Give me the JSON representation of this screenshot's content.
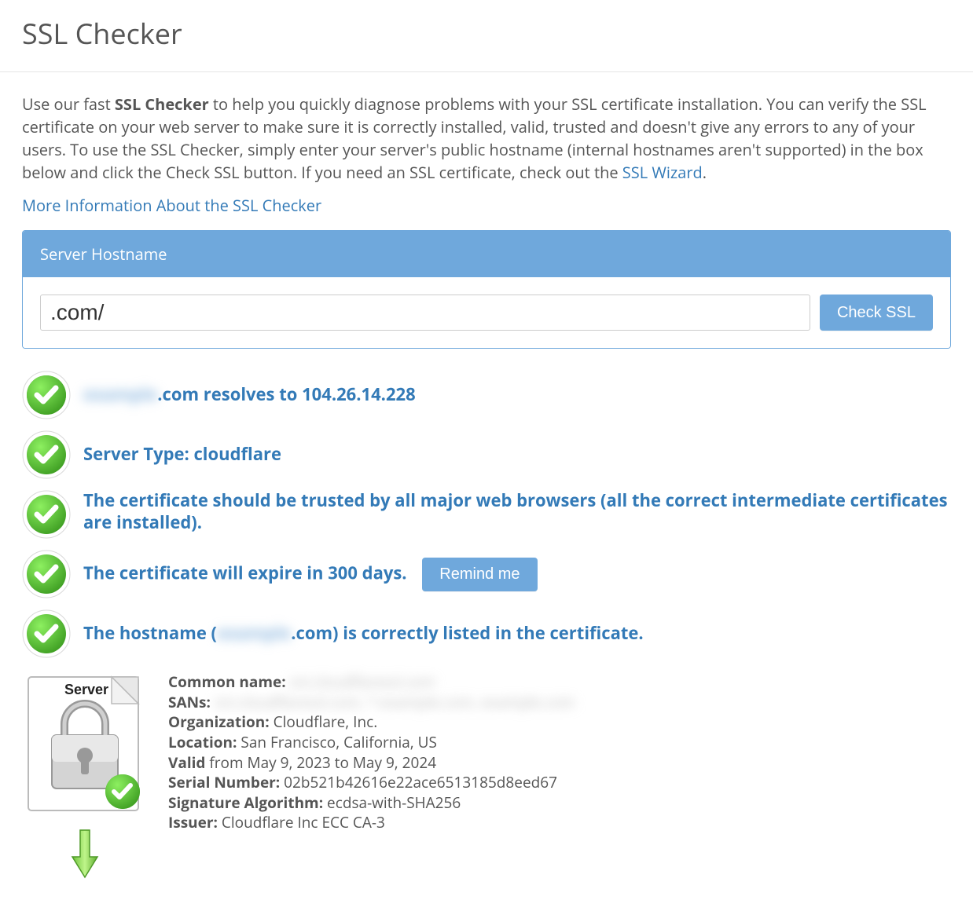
{
  "title": "SSL Checker",
  "intro": {
    "prefix": "Use our fast ",
    "strong": "SSL Checker",
    "rest": " to help you quickly diagnose problems with your SSL certificate installation. You can verify the SSL certificate on your web server to make sure it is correctly installed, valid, trusted and doesn't give any errors to any of your users. To use the SSL Checker, simply enter your server's public hostname (internal hostnames aren't supported) in the box below and click the Check SSL button. If you need an SSL certificate, check out the ",
    "link_ssl_wizard": "SSL Wizard",
    "period": "."
  },
  "more_info_link": "More Information About the SSL Checker",
  "panel": {
    "head": "Server Hostname"
  },
  "input": {
    "value": "",
    "display_suffix": ".com/"
  },
  "buttons": {
    "check_ssl": "Check SSL",
    "remind_me": "Remind me"
  },
  "checks": {
    "resolve_prefix_hidden": "example",
    "resolve_suffix": ".com resolves to 104.26.14.228",
    "server_type": "Server Type: cloudflare",
    "trusted": "The certificate should be trusted by all major web browsers (all the correct intermediate certificates are installed).",
    "expiry": "The certificate will expire in 300 days.",
    "hostname_pre": "The hostname (",
    "hostname_hidden": "example",
    "hostname_post": ".com) is correctly listed in the certificate."
  },
  "cert": {
    "common_name_label": "Common name:",
    "common_name_hidden": "sni.cloudflaressl.com",
    "sans_label": "SANs:",
    "sans_hidden": "sni.cloudflaressl.com, *.example.com, example.com",
    "org_label": "Organization:",
    "org_value": " Cloudflare, Inc.",
    "loc_label": "Location:",
    "loc_value": " San Francisco, California, US",
    "valid_label": "Valid",
    "valid_value": " from May 9, 2023 to May 9, 2024",
    "serial_label": "Serial Number:",
    "serial_value": " 02b521b42616e22ace6513185d8eed67",
    "sigalg_label": "Signature Algorithm:",
    "sigalg_value": " ecdsa-with-SHA256",
    "issuer_label": "Issuer:",
    "issuer_value": " Cloudflare Inc ECC CA-3"
  },
  "icons": {
    "server_label": "Server"
  }
}
